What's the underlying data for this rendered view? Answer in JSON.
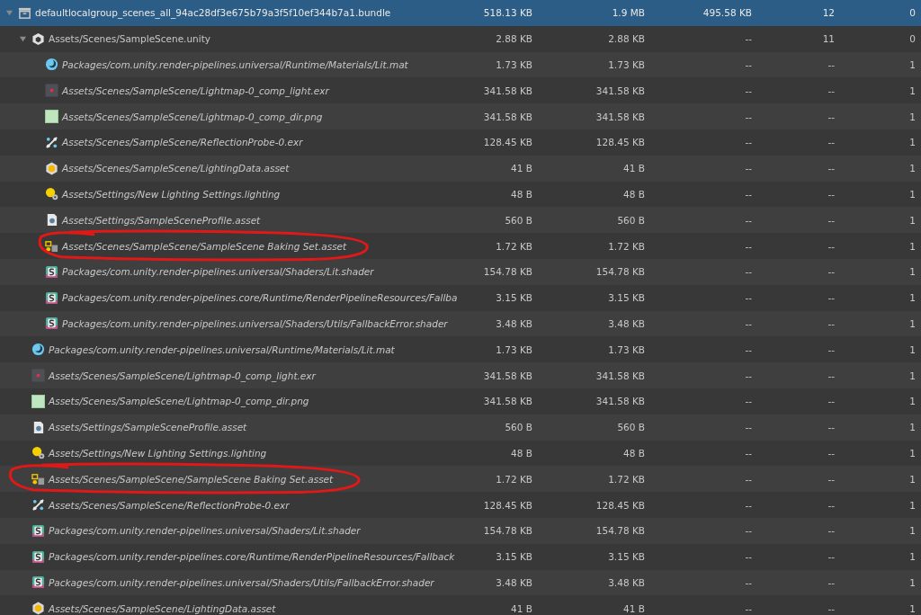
{
  "tree": [
    {
      "kind": "bundle",
      "name": "defaultlocalgroup_scenes_all_94ac28df3e675b79a3f5f10ef344b7a1.bundle",
      "cells": [
        "518.13 KB",
        "1.9 MB",
        "495.58 KB",
        "12",
        "0"
      ],
      "selected": true,
      "expanded": true,
      "circled": false,
      "children": [
        {
          "kind": "scene",
          "name": "Assets/Scenes/SampleScene.unity",
          "cells": [
            "2.88 KB",
            "2.88 KB",
            "--",
            "11",
            "0"
          ],
          "selected": false,
          "expanded": true,
          "circled": false,
          "children": [
            {
              "kind": "material",
              "name": "Packages/com.unity.render-pipelines.universal/Runtime/Materials/Lit.mat",
              "cells": [
                "1.73 KB",
                "1.73 KB",
                "--",
                "--",
                "1"
              ],
              "selected": false,
              "circled": false
            },
            {
              "kind": "exr",
              "name": "Assets/Scenes/SampleScene/Lightmap-0_comp_light.exr",
              "cells": [
                "341.58 KB",
                "341.58 KB",
                "--",
                "--",
                "1"
              ],
              "selected": false,
              "circled": false
            },
            {
              "kind": "texture",
              "name": "Assets/Scenes/SampleScene/Lightmap-0_comp_dir.png",
              "cells": [
                "341.58 KB",
                "341.58 KB",
                "--",
                "--",
                "1"
              ],
              "selected": false,
              "circled": false
            },
            {
              "kind": "probe",
              "name": "Assets/Scenes/SampleScene/ReflectionProbe-0.exr",
              "cells": [
                "128.45 KB",
                "128.45 KB",
                "--",
                "--",
                "1"
              ],
              "selected": false,
              "circled": false
            },
            {
              "kind": "lightingdata",
              "name": "Assets/Scenes/SampleScene/LightingData.asset",
              "cells": [
                "41 B",
                "41 B",
                "--",
                "--",
                "1"
              ],
              "selected": false,
              "circled": false
            },
            {
              "kind": "lighting",
              "name": "Assets/Settings/New Lighting Settings.lighting",
              "cells": [
                "48 B",
                "48 B",
                "--",
                "--",
                "1"
              ],
              "selected": false,
              "circled": false
            },
            {
              "kind": "profile",
              "name": "Assets/Settings/SampleSceneProfile.asset",
              "cells": [
                "560 B",
                "560 B",
                "--",
                "--",
                "1"
              ],
              "selected": false,
              "circled": false
            },
            {
              "kind": "bakingset",
              "name": "Assets/Scenes/SampleScene/SampleScene Baking Set.asset",
              "cells": [
                "1.72 KB",
                "1.72 KB",
                "--",
                "--",
                "1"
              ],
              "selected": false,
              "circled": true
            },
            {
              "kind": "shader",
              "name": "Packages/com.unity.render-pipelines.universal/Shaders/Lit.shader",
              "cells": [
                "154.78 KB",
                "154.78 KB",
                "--",
                "--",
                "1"
              ],
              "selected": false,
              "circled": false
            },
            {
              "kind": "shader",
              "name": "Packages/com.unity.render-pipelines.core/Runtime/RenderPipelineResources/Fallba",
              "cells": [
                "3.15 KB",
                "3.15 KB",
                "--",
                "--",
                "1"
              ],
              "selected": false,
              "circled": false
            },
            {
              "kind": "shader",
              "name": "Packages/com.unity.render-pipelines.universal/Shaders/Utils/FallbackError.shader",
              "cells": [
                "3.48 KB",
                "3.48 KB",
                "--",
                "--",
                "1"
              ],
              "selected": false,
              "circled": false
            }
          ]
        },
        {
          "kind": "material",
          "name": "Packages/com.unity.render-pipelines.universal/Runtime/Materials/Lit.mat",
          "cells": [
            "1.73 KB",
            "1.73 KB",
            "--",
            "--",
            "1"
          ],
          "selected": false,
          "circled": false
        },
        {
          "kind": "exr",
          "name": "Assets/Scenes/SampleScene/Lightmap-0_comp_light.exr",
          "cells": [
            "341.58 KB",
            "341.58 KB",
            "--",
            "--",
            "1"
          ],
          "selected": false,
          "circled": false
        },
        {
          "kind": "texture",
          "name": "Assets/Scenes/SampleScene/Lightmap-0_comp_dir.png",
          "cells": [
            "341.58 KB",
            "341.58 KB",
            "--",
            "--",
            "1"
          ],
          "selected": false,
          "circled": false
        },
        {
          "kind": "profile",
          "name": "Assets/Settings/SampleSceneProfile.asset",
          "cells": [
            "560 B",
            "560 B",
            "--",
            "--",
            "1"
          ],
          "selected": false,
          "circled": false
        },
        {
          "kind": "lighting",
          "name": "Assets/Settings/New Lighting Settings.lighting",
          "cells": [
            "48 B",
            "48 B",
            "--",
            "--",
            "1"
          ],
          "selected": false,
          "circled": false
        },
        {
          "kind": "bakingset",
          "name": "Assets/Scenes/SampleScene/SampleScene Baking Set.asset",
          "cells": [
            "1.72 KB",
            "1.72 KB",
            "--",
            "--",
            "1"
          ],
          "selected": false,
          "circled": true
        },
        {
          "kind": "probe",
          "name": "Assets/Scenes/SampleScene/ReflectionProbe-0.exr",
          "cells": [
            "128.45 KB",
            "128.45 KB",
            "--",
            "--",
            "1"
          ],
          "selected": false,
          "circled": false
        },
        {
          "kind": "shader",
          "name": "Packages/com.unity.render-pipelines.universal/Shaders/Lit.shader",
          "cells": [
            "154.78 KB",
            "154.78 KB",
            "--",
            "--",
            "1"
          ],
          "selected": false,
          "circled": false
        },
        {
          "kind": "shader",
          "name": "Packages/com.unity.render-pipelines.core/Runtime/RenderPipelineResources/Fallback",
          "cells": [
            "3.15 KB",
            "3.15 KB",
            "--",
            "--",
            "1"
          ],
          "selected": false,
          "circled": false
        },
        {
          "kind": "shader",
          "name": "Packages/com.unity.render-pipelines.universal/Shaders/Utils/FallbackError.shader",
          "cells": [
            "3.48 KB",
            "3.48 KB",
            "--",
            "--",
            "1"
          ],
          "selected": false,
          "circled": false
        },
        {
          "kind": "lightingdata",
          "name": "Assets/Scenes/SampleScene/LightingData.asset",
          "cells": [
            "41 B",
            "41 B",
            "--",
            "--",
            "1"
          ],
          "selected": false,
          "circled": false
        }
      ]
    }
  ]
}
